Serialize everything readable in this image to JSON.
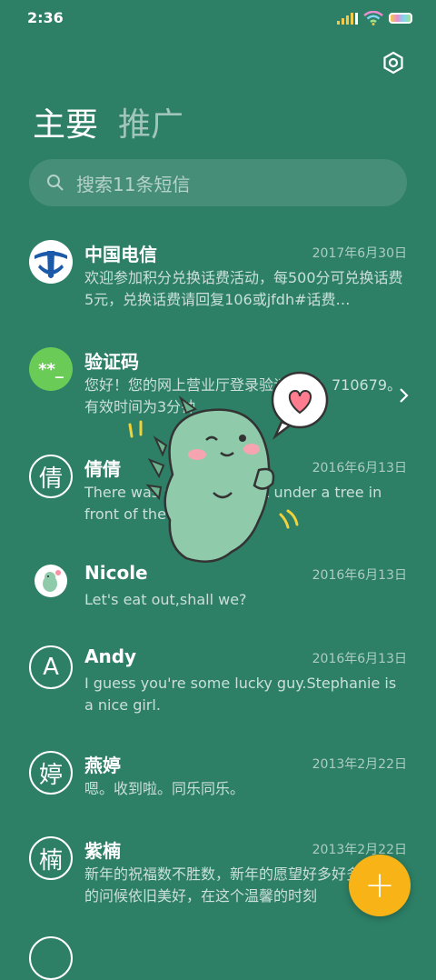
{
  "status_bar": {
    "time": "2:36"
  },
  "tabs": {
    "main": "主要",
    "promo": "推广"
  },
  "search": {
    "placeholder": "搜索11条短信"
  },
  "conversations": [
    {
      "name": "中国电信",
      "date": "2017年6月30日",
      "preview": "欢迎参加积分兑换话费活动，每500分可兑换话费5元，兑换话费请回复106或jfdh#话费…"
    },
    {
      "name": "验证码",
      "date": "",
      "preview": "您好！您的网上营业厅登录验证码为：710679。有效时间为3分钟",
      "avatar_text": "**_"
    },
    {
      "name": "倩倩",
      "date": "2016年6月13日",
      "preview": "There was a table set out under a tree in front of the hous",
      "avatar_text": "倩"
    },
    {
      "name": "Nicole",
      "date": "2016年6月13日",
      "preview": "Let's eat out,shall we?"
    },
    {
      "name": "Andy",
      "date": "2016年6月13日",
      "preview": "I guess you're some lucky guy.Stephanie is a nice girl.",
      "avatar_text": "A"
    },
    {
      "name": "燕婷",
      "date": "2013年2月22日",
      "preview": "嗯。收到啦。同乐同乐。",
      "avatar_text": "婷"
    },
    {
      "name": "紫楠",
      "date": "2013年2月22日",
      "preview": "新年的祝福数不胜数，新年的愿望好多好多，新年的问候依旧美好，在这个温馨的时刻",
      "avatar_text": "楠"
    }
  ],
  "colors": {
    "background": "#2d7f66",
    "fab": "#f8b417",
    "telecom_blue": "#1a5aa8",
    "verify_green": "#6bcb57"
  },
  "fab": {
    "icon": "plus-icon"
  }
}
